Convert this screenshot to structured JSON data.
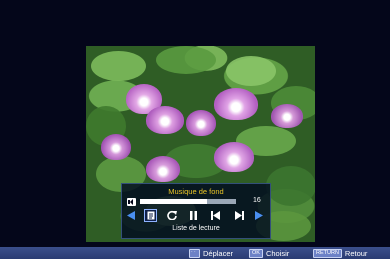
{
  "panel": {
    "title": "Musique de fond",
    "volume_value": "16",
    "volume_level_percent": 70,
    "caption": "Liste de lecture",
    "buttons": [
      {
        "name": "prev-arrow",
        "icon": "left-arrow-icon"
      },
      {
        "name": "playlist",
        "icon": "document-icon",
        "selected": true
      },
      {
        "name": "repeat",
        "icon": "repeat-icon"
      },
      {
        "name": "pause",
        "icon": "pause-icon"
      },
      {
        "name": "skip-back",
        "icon": "skip-previous-icon"
      },
      {
        "name": "skip-forward",
        "icon": "skip-next-icon"
      },
      {
        "name": "next-arrow",
        "icon": "right-arrow-icon"
      }
    ]
  },
  "bottom_bar": {
    "move_label": "Déplacer",
    "ok_key": "OK",
    "select_label": "Choisir",
    "return_key": "RETURN",
    "return_label": "Retour"
  },
  "colors": {
    "background": "#04061a",
    "title": "#e8c426",
    "arrow_blue": "#4a8ff0",
    "bar": "#34478a"
  }
}
